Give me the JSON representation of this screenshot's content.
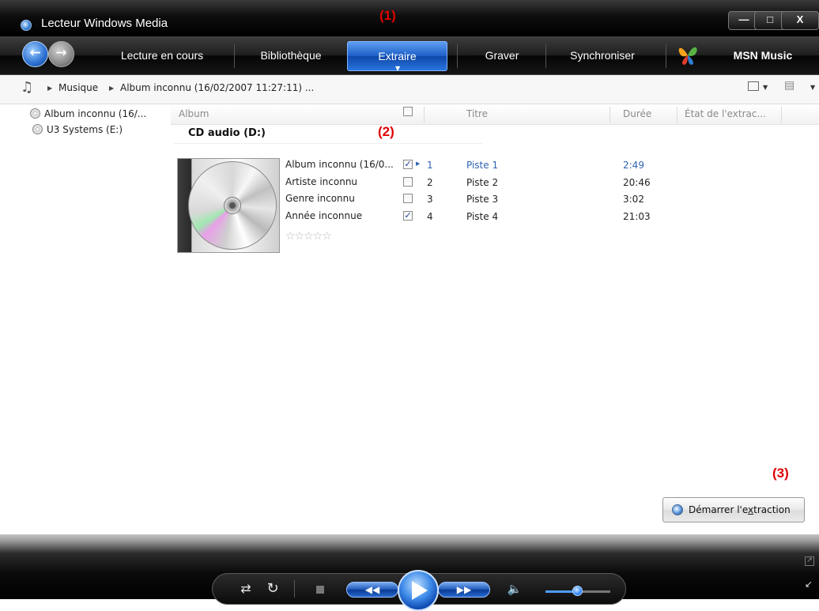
{
  "window": {
    "title": "Lecteur Windows Media",
    "buttons": {
      "minimize": "—",
      "maximize": "□",
      "close": "X"
    }
  },
  "nav": {
    "tabs": [
      {
        "label": "Lecture en cours",
        "active": false
      },
      {
        "label": "Bibliothèque",
        "active": false
      },
      {
        "label": "Extraire",
        "active": true
      },
      {
        "label": "Graver",
        "active": false
      },
      {
        "label": "Synchroniser",
        "active": false
      },
      {
        "label": "MSN Music",
        "active": false
      }
    ]
  },
  "breadcrumb": {
    "items": [
      "Musique",
      "Album inconnu (16/02/2007 11:27:11) ..."
    ]
  },
  "tree": {
    "items": [
      {
        "label": "Album inconnu (16/...",
        "selected": true
      },
      {
        "label": "U3 Systems (E:)",
        "selected": false
      }
    ]
  },
  "columns": {
    "album": "Album",
    "title": "Titre",
    "duration": "Durée",
    "rip_status": "État de l'extrac..."
  },
  "cd_label": "CD audio (D:)",
  "album_meta": {
    "album": "Album inconnu (16/0...",
    "artist": "Artiste inconnu",
    "genre": "Genre inconnu",
    "year": "Année inconnue",
    "rating_stars": 0,
    "rating_max": 5
  },
  "tracks": [
    {
      "checked": true,
      "number": "1",
      "title": "Piste 1",
      "duration": "2:49",
      "selected": true
    },
    {
      "checked": false,
      "number": "2",
      "title": "Piste 2",
      "duration": "20:46",
      "selected": false
    },
    {
      "checked": false,
      "number": "3",
      "title": "Piste 3",
      "duration": "3:02",
      "selected": false
    },
    {
      "checked": true,
      "number": "4",
      "title": "Piste 4",
      "duration": "21:03",
      "selected": false
    }
  ],
  "start_rip_button": {
    "prefix": "Démarrer l'e",
    "accel": "x",
    "suffix": "traction"
  },
  "annotations": [
    "(1)",
    "(2)",
    "(3)"
  ],
  "volume_level": 0.5,
  "colors": {
    "accent": "#1c5fc7",
    "selected_text": "#2f63b5",
    "annotation": "#e00000"
  },
  "icons": {
    "back": "back-arrow-icon",
    "forward": "forward-arrow-icon",
    "music": "music-note-icon",
    "shuffle": "shuffle-icon",
    "repeat": "repeat-icon",
    "stop": "stop-icon",
    "previous": "previous-icon",
    "play": "play-icon",
    "next": "next-icon",
    "volume": "speaker-icon"
  }
}
